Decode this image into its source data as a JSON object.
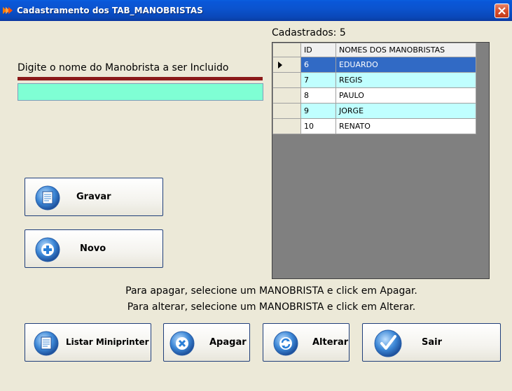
{
  "window": {
    "title": "Cadastramento dos TAB_MANOBRISTAS"
  },
  "form": {
    "prompt_label": "Digite o nome do Manobrista a ser Incluido",
    "name_value": "",
    "count_label": "Cadastrados: 5"
  },
  "grid": {
    "columns": [
      "ID",
      "NOMES DOS MANOBRISTAS"
    ],
    "rows": [
      {
        "id": "6",
        "name": "EDUARDO"
      },
      {
        "id": "7",
        "name": "REGIS"
      },
      {
        "id": "8",
        "name": "PAULO"
      },
      {
        "id": "9",
        "name": "JORGE"
      },
      {
        "id": "10",
        "name": "RENATO"
      }
    ],
    "selected_row_index": 0
  },
  "buttons": {
    "gravar": "Gravar",
    "novo": "Novo",
    "listar": "Listar Miniprinter",
    "apagar": "Apagar",
    "alterar": "Alterar",
    "sair": "Sair"
  },
  "info": {
    "line1": "Para apagar, selecione um MANOBRISTA e click em Apagar.",
    "line2": "Para alterar, selecione um MANOBRISTA e click em Alterar."
  },
  "icons": {
    "gravar": "document-icon",
    "novo": "plus-icon",
    "listar": "document-icon",
    "apagar": "x-icon",
    "alterar": "refresh-icon",
    "sair": "checkmark-icon"
  },
  "colors": {
    "titlebar": "#0A54CF",
    "input_bg": "#7FFFD4",
    "underline": "#8B1A1A",
    "selected_row": "#316AC5",
    "alt_row": "#C0FFFF",
    "grid_bg": "#808080"
  }
}
